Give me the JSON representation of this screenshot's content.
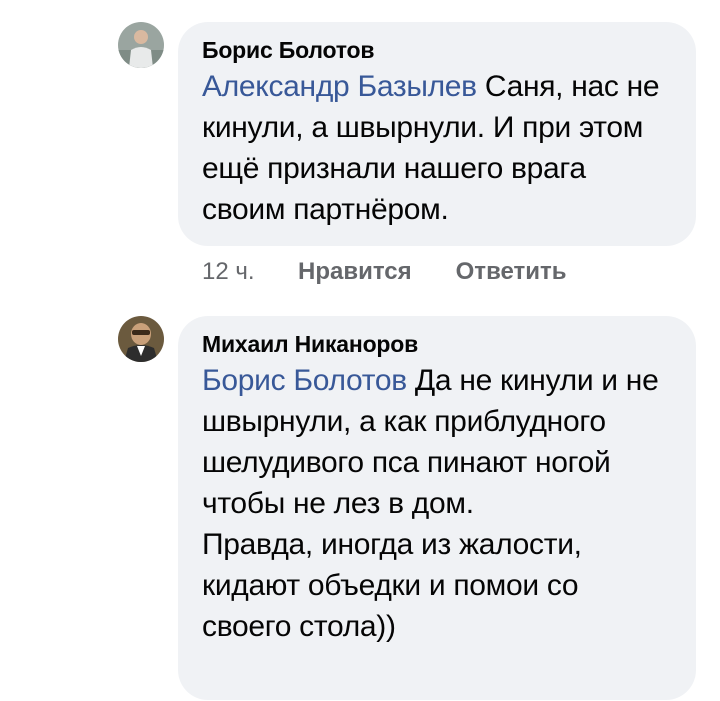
{
  "comments": [
    {
      "author": "Борис Болотов",
      "mention": "Александр Базылев",
      "text": " Саня, нас не кинули, а швырнули. И при этом ещё признали нашего врага своим партнёром.",
      "time": "12 ч.",
      "like_label": "Нравится",
      "reply_label": "Ответить"
    },
    {
      "author": "Михаил Никаноров",
      "mention": "Борис Болотов",
      "text": " Да не кинули и не швырнули, а как приблудного шелудивого пса пинают ногой чтобы не лез в дом.",
      "text2": "Правда, иногда из жалости, кидают объедки и помои со своего стола))"
    }
  ]
}
